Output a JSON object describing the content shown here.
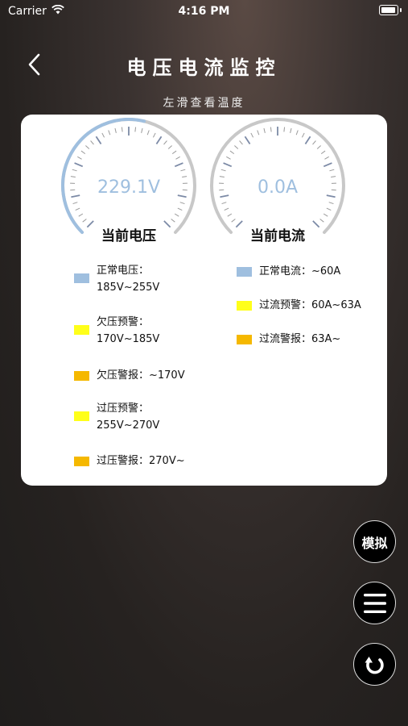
{
  "status_bar": {
    "carrier": "Carrier",
    "time": "4:16 PM",
    "wifi_icon": "wifi-icon",
    "battery_icon": "battery-icon"
  },
  "nav": {
    "back_icon": "chevron-left-icon",
    "title": "电压电流监控"
  },
  "subtitle": "左滑查看温度",
  "gauges": {
    "voltage": {
      "value": "229.1V",
      "label": "当前电压",
      "value_color": "#9fbfdf",
      "arc_color": "#9fbfdf",
      "fill_fraction": 0.55
    },
    "current": {
      "value": "0.0A",
      "label": "当前电流",
      "value_color": "#9fbfdf",
      "arc_color": "#c8c8c8",
      "fill_fraction": 0.0
    }
  },
  "legend_voltage": [
    {
      "line1": "正常电压：",
      "line2": "185V~255V",
      "color": "#9fbfdf"
    },
    {
      "line1": "欠压预警：",
      "line2": "170V~185V",
      "color": "#ffff1a"
    },
    {
      "line1": "欠压警报：~170V",
      "line2": "",
      "color": "#f5b800"
    },
    {
      "line1": "过压预警：",
      "line2": "255V~270V",
      "color": "#ffff1a"
    },
    {
      "line1": "过压警报：270V~",
      "line2": "",
      "color": "#f5b800"
    }
  ],
  "legend_current": [
    {
      "text": "正常电流：~60A",
      "color": "#9fbfdf"
    },
    {
      "text": "过流预警：60A~63A",
      "color": "#ffff1a"
    },
    {
      "text": "过流警报：63A~",
      "color": "#f5b800"
    }
  ],
  "buttons": {
    "simulate_label": "模拟",
    "menu_icon": "menu-icon",
    "refresh_icon": "refresh-icon"
  }
}
